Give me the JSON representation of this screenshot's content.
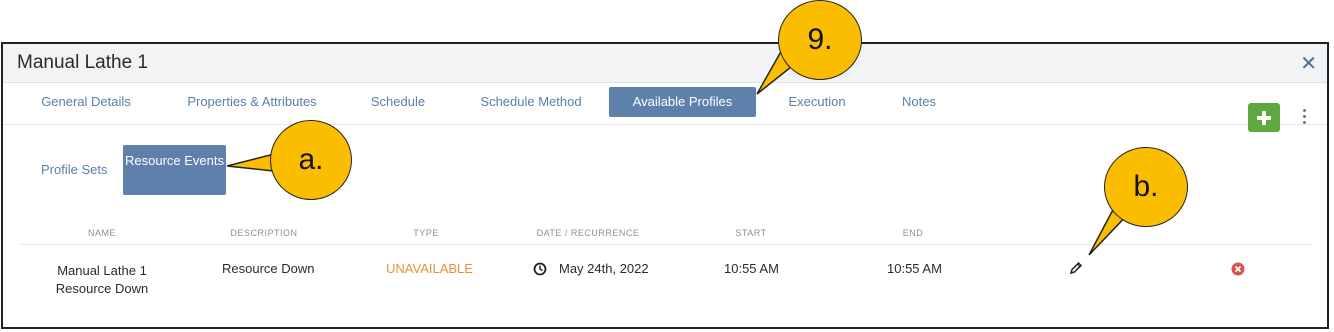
{
  "window": {
    "title": "Manual Lathe 1"
  },
  "tabs": [
    {
      "label": "General Details",
      "active": false
    },
    {
      "label": "Properties & Attributes",
      "active": false
    },
    {
      "label": "Schedule",
      "active": false
    },
    {
      "label": "Schedule Method",
      "active": false
    },
    {
      "label": "Available Profiles",
      "active": true
    },
    {
      "label": "Execution",
      "active": false
    },
    {
      "label": "Notes",
      "active": false
    }
  ],
  "subtabs": [
    {
      "label": "Profile Sets",
      "active": false
    },
    {
      "label": "Resource Events",
      "active": true
    }
  ],
  "table": {
    "headers": [
      "NAME",
      "DESCRIPTION",
      "TYPE",
      "DATE / RECURRENCE",
      "START",
      "END"
    ],
    "rows": [
      {
        "name": "Manual Lathe 1 Resource Down",
        "description": "Resource Down",
        "type": "UNAVAILABLE",
        "date": "May 24th, 2022",
        "start": "10:55 AM",
        "end": "10:55 AM"
      }
    ]
  },
  "colors": {
    "accent": "#5e81ac",
    "unavailable": "#e8913a",
    "add": "#5fa83f",
    "delete": "#d9534f",
    "callout": "#fbbd00"
  },
  "icons": [
    "close-icon",
    "plus-icon",
    "kebab-menu-icon",
    "clock-icon",
    "pencil-icon",
    "delete-circle-icon"
  ],
  "callouts": [
    "9.",
    "a.",
    "b."
  ]
}
